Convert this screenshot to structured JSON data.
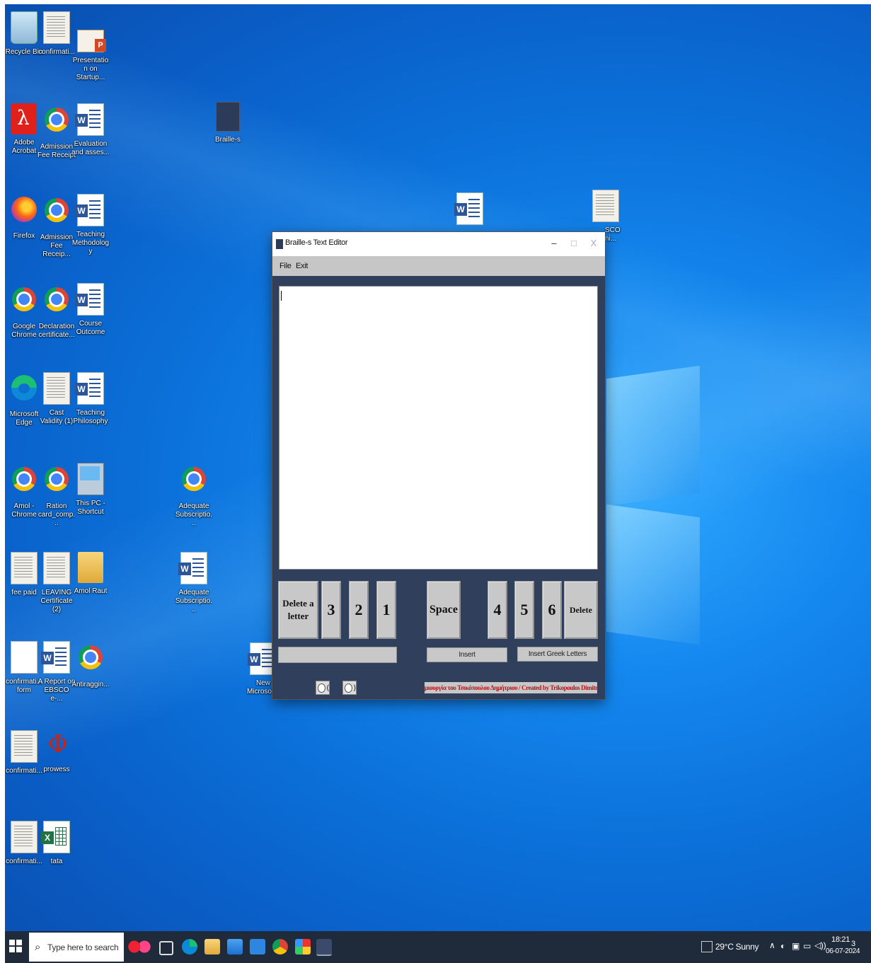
{
  "desktop_icons": [
    {
      "label": "Recycle Bin",
      "icon": "recycle-bin-icon"
    },
    {
      "label": "confirmati...",
      "icon": "document-scan-icon"
    },
    {
      "label": "Presentation on Startup...",
      "icon": "powerpoint-icon"
    },
    {
      "label": "Adobe Acrobat",
      "icon": "adobe-acrobat-icon"
    },
    {
      "label": "Admission Fee Receipt",
      "icon": "chrome-icon"
    },
    {
      "label": "Evaluation and asses...",
      "icon": "word-document-icon"
    },
    {
      "label": "Braille-s",
      "icon": "braille-app-icon"
    },
    {
      "label": "Firefox",
      "icon": "firefox-icon"
    },
    {
      "label": "Admission Fee Receip...",
      "icon": "chrome-icon"
    },
    {
      "label": "Teaching Methodology",
      "icon": "word-document-icon"
    },
    {
      "label": "Google Chrome",
      "icon": "chrome-icon"
    },
    {
      "label": "Declaration certificate...",
      "icon": "chrome-icon"
    },
    {
      "label": "Course Outcome",
      "icon": "word-document-icon"
    },
    {
      "label": "Microsoft Edge",
      "icon": "edge-icon"
    },
    {
      "label": "Cast Validity (1)",
      "icon": "document-scan-icon"
    },
    {
      "label": "Teaching Philosophy",
      "icon": "word-document-icon"
    },
    {
      "label": "Amol - Chrome",
      "icon": "chrome-profile-icon"
    },
    {
      "label": "Ration card_comp...",
      "icon": "chrome-icon"
    },
    {
      "label": "This PC - Shortcut",
      "icon": "this-pc-icon"
    },
    {
      "label": "Adequate Subscriptio...",
      "icon": "chrome-icon"
    },
    {
      "label": "fee paid",
      "icon": "document-scan-icon"
    },
    {
      "label": "LEAVING Certificate (2)",
      "icon": "document-scan-icon"
    },
    {
      "label": "Amol Raut",
      "icon": "folder-icon"
    },
    {
      "label": "Adequate Subscriptio...",
      "icon": "word-document-icon"
    },
    {
      "label": "confirmati... form",
      "icon": "blank-document-icon"
    },
    {
      "label": "A Report on EBSCO e-...",
      "icon": "word-document-icon"
    },
    {
      "label": "Antiraggin...",
      "icon": "chrome-icon"
    },
    {
      "label": "New Microsof...",
      "icon": "word-document-icon"
    },
    {
      "label": "confirmati...",
      "icon": "document-scan-icon"
    },
    {
      "label": "prowess",
      "icon": "prowess-icon"
    },
    {
      "label": "confirmati...",
      "icon": "document-scan-icon"
    },
    {
      "label": "tata",
      "icon": "excel-icon"
    },
    {
      "label": "",
      "icon": "word-document-icon"
    },
    {
      "label": "SCO ni...",
      "icon": "document-scan-icon"
    }
  ],
  "window": {
    "title": "Braille-s Text Editor",
    "minimize": "–",
    "maximize": "□",
    "close": "X",
    "menu": [
      "File",
      "Exit"
    ],
    "editor_text": "",
    "buttons": {
      "delete_letter": "Delete a letter",
      "dot3": "3",
      "dot2": "2",
      "dot1": "1",
      "space": "Space",
      "dot4": "4",
      "dot5": "5",
      "dot6": "6",
      "delete": "Delete",
      "insert": "Insert",
      "insert_greek": "Insert Greek Letters"
    },
    "preview_value": "",
    "radio_a": "(",
    "radio_b": ")",
    "credit": "Δημιουργία του Τσικόπουλου Δημήτριου / Created by Trikopoulos Dimitrios"
  },
  "taskbar": {
    "search_placeholder": "Type here to search",
    "weather": "29°C  Sunny",
    "time": "18:21",
    "date": "06-07-2024",
    "notifications": "3"
  },
  "colors": {
    "desktop": "#0b6fd8",
    "window_body": "#2f3f5c",
    "button_gray": "#c8c8c8",
    "credit_red": "#b3141b",
    "taskbar": "#1f2a3a"
  }
}
